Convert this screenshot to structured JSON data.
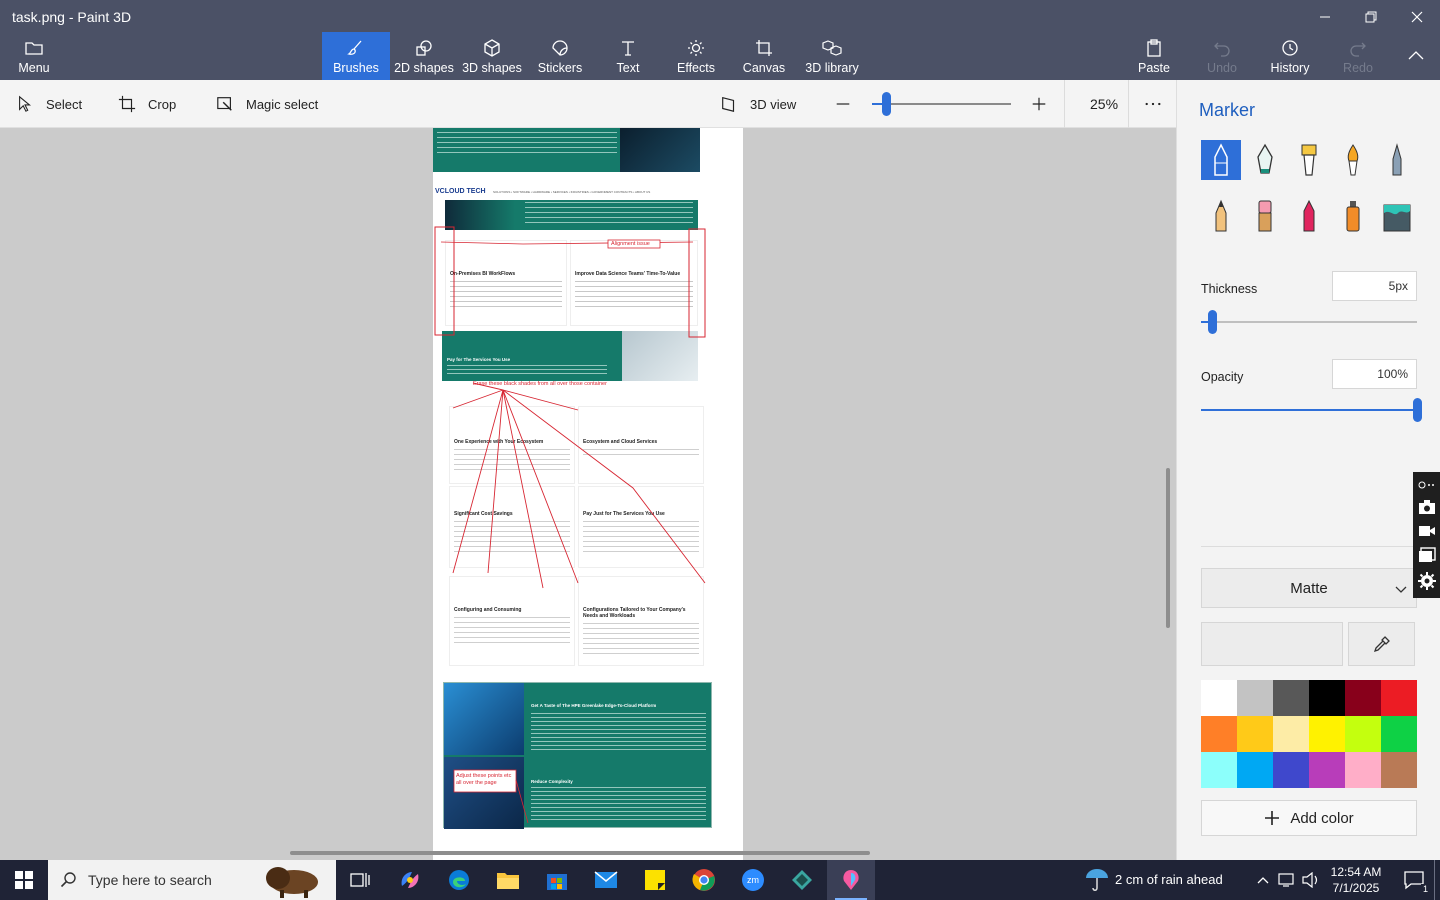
{
  "window": {
    "title": "task.png - Paint 3D",
    "minimize_icon": "minimize-icon",
    "maximize_icon": "restore-icon",
    "close_icon": "close-icon"
  },
  "ribbon": {
    "menu_label": "Menu",
    "tabs": [
      {
        "label": "Brushes",
        "icon": "brush-icon",
        "active": true
      },
      {
        "label": "2D shapes",
        "icon": "2d-shapes-icon"
      },
      {
        "label": "3D shapes",
        "icon": "3d-shapes-icon"
      },
      {
        "label": "Stickers",
        "icon": "sticker-icon"
      },
      {
        "label": "Text",
        "icon": "text-icon"
      },
      {
        "label": "Effects",
        "icon": "sun-icon"
      },
      {
        "label": "Canvas",
        "icon": "canvas-icon"
      },
      {
        "label": "3D library",
        "icon": "3d-library-icon"
      }
    ],
    "paste_label": "Paste",
    "undo_label": "Undo",
    "history_label": "History",
    "redo_label": "Redo"
  },
  "toolbar": {
    "select_label": "Select",
    "crop_label": "Crop",
    "magic_select_label": "Magic select",
    "view3d_label": "3D view",
    "zoom_value": "25%",
    "zoom_fraction": 0.12
  },
  "canvas_content": {
    "logo": "VCLOUD TECH",
    "nav": "SOLUTIONS  •  SOFTWARE  •  HARDWARE  •  SERVICES  •  INDUSTRIES  •  GOVERNMENT CONTRACTS  •  ABOUT US",
    "annotation_alignment": "Alignment issue",
    "annotation_erase": "Erase these black shades from all over those container",
    "annotation_adjust": "Adjust these points etc all over the page",
    "card1_title": "On-Premises BI WorkFlows",
    "card2_title": "Improve Data Science Teams' Time-To-Value",
    "pay_title": "Pay for The Services You Use",
    "grid": [
      {
        "title": "One Experience with Your Ecosystem"
      },
      {
        "title": "Ecosystem and Cloud Services"
      },
      {
        "title": "Significant Cost Savings"
      },
      {
        "title": "Pay Just for The Services You Use"
      },
      {
        "title": "Configuring and Consuming"
      },
      {
        "title": "Configurations Tailored to Your Company's Needs and Workloads"
      }
    ],
    "bottom1_title": "Get A Taste of The HPE Greenlake Edge-To-Cloud Platform",
    "bottom2_title": "Reduce Complexity"
  },
  "panel": {
    "title": "Marker",
    "brushes": [
      "marker-icon",
      "calligraphy-pen-icon",
      "oil-brush-icon",
      "watercolor-icon",
      "pixel-pen-icon",
      "pencil-icon",
      "eraser-icon",
      "crayon-icon",
      "spray-can-icon",
      "fill-icon"
    ],
    "thickness_label": "Thickness",
    "thickness_value": "5px",
    "thickness_fraction": 0.04,
    "opacity_label": "Opacity",
    "opacity_value": "100%",
    "opacity_fraction": 1.0,
    "finish_label": "Matte",
    "add_color_label": "Add color",
    "swatches": [
      "#ffffff",
      "#c3c3c3",
      "#585858",
      "#000000",
      "#88001b",
      "#ec1c24",
      "#ff7f27",
      "#ffca18",
      "#fdeca6",
      "#fff200",
      "#c4ff0e",
      "#0ed145",
      "#8cfffb",
      "#00a8f3",
      "#3f48cc",
      "#b83dba",
      "#ffaec8",
      "#b97a56"
    ]
  },
  "taskbar": {
    "search_placeholder": "Type here to search",
    "weather": "2 cm of rain ahead",
    "time": "12:54 AM",
    "date": "7/1/2025",
    "notification_count": "1"
  }
}
